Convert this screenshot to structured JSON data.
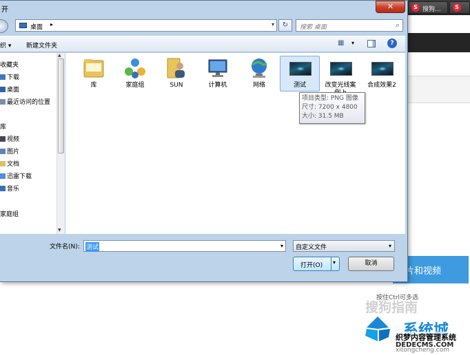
{
  "browser": {
    "tab1_label": "搜狗...",
    "tab2_label": "S"
  },
  "page": {
    "upload_button_label": "片和视频",
    "hint": "按住Ctrl可多选"
  },
  "watermarks": {
    "sogou": "搜狗指南",
    "brand": "系统城",
    "site_name": "织梦内容管理系统",
    "domain": "DEDECMS.COM",
    "url": "xitongcheng.com"
  },
  "dialog": {
    "title": "开",
    "close_label": "✕",
    "address": {
      "crumb": "桌面",
      "crumb_arrow": "▸",
      "dropdown": "▾"
    },
    "refresh_label": "↻",
    "search_placeholder": "搜索 桌面",
    "toolbar": {
      "organize_label": "织 ▾",
      "new_folder_label": "新建文件夹",
      "help_label": "?"
    },
    "nav": {
      "items": [
        {
          "label": "收藏夹"
        },
        {
          "label": "下载"
        },
        {
          "label": "桌面"
        },
        {
          "label": "最近访问的位置"
        },
        {
          "label": "库"
        },
        {
          "label": "视频"
        },
        {
          "label": "图片"
        },
        {
          "label": "文档"
        },
        {
          "label": "迅雷下载"
        },
        {
          "label": "音乐"
        },
        {
          "label": "家庭组"
        }
      ]
    },
    "files": [
      {
        "label": "库",
        "icon": "library-icon"
      },
      {
        "label": "家庭组",
        "icon": "homegroup-icon"
      },
      {
        "label": "SUN",
        "icon": "user-folder-icon"
      },
      {
        "label": "计算机",
        "icon": "computer-icon"
      },
      {
        "label": "网络",
        "icon": "network-icon"
      },
      {
        "label": "测试",
        "icon": "image-thumbnail-icon"
      },
      {
        "label": "改变光线案例.html",
        "label_visible": "改变光线案\n例.h",
        "icon": "image-thumbnail-icon"
      },
      {
        "label": "合成效果2",
        "icon": "image-thumbnail-icon"
      }
    ],
    "tooltip": {
      "line1": "项目类型: PNG 图像",
      "line2": "尺寸: 7200 x 4800",
      "line3": "大小: 31.5 MB"
    },
    "filename_label": "文件名(N):",
    "filename_value": "测试",
    "filetype_value": "自定义文件",
    "open_label": "打开(O)",
    "cancel_label": "取消"
  }
}
